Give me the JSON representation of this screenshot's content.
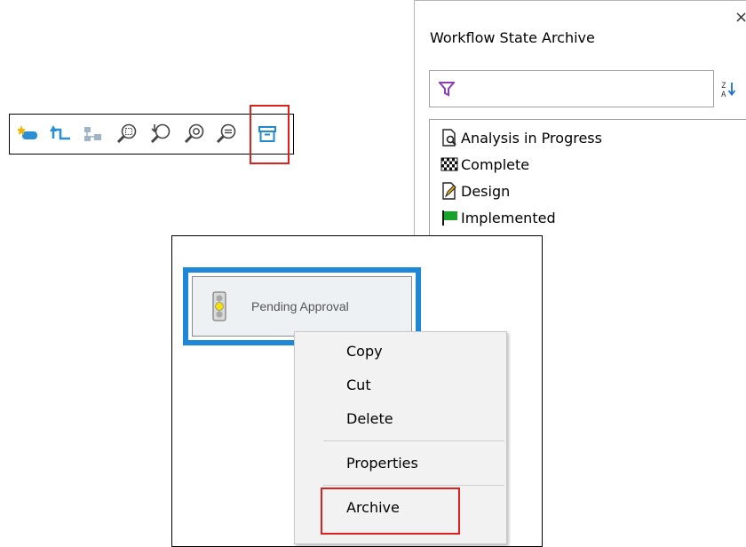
{
  "toolbar": {
    "buttons": [
      {
        "name": "new-state-icon"
      },
      {
        "name": "add-transition-icon"
      },
      {
        "name": "auto-layout-icon"
      },
      {
        "name": "zoom-selection-icon"
      },
      {
        "name": "zoom-fit-icon"
      },
      {
        "name": "zoom-in-icon"
      },
      {
        "name": "zoom-out-icon"
      },
      {
        "name": "archive-icon"
      }
    ]
  },
  "archive_panel": {
    "title": "Workflow State Archive",
    "close_glyph": "×",
    "states": [
      {
        "label": "Analysis in Progress",
        "icon": "magnifier-document-icon"
      },
      {
        "label": "Complete",
        "icon": "checkered-flag-icon"
      },
      {
        "label": "Design",
        "icon": "pencil-document-icon"
      },
      {
        "label": "Implemented",
        "icon": "green-flag-icon"
      }
    ]
  },
  "state_card": {
    "label": "Pending Approval",
    "icon": "traffic-light-icon"
  },
  "context_menu": {
    "items": [
      "Copy",
      "Cut",
      "Delete",
      "Properties",
      "Archive"
    ]
  },
  "colors": {
    "highlight": "#e0201c",
    "selection_border": "#1e87d6",
    "icon_blue": "#1f8ad1",
    "filter_purple": "#8b3fb5"
  }
}
